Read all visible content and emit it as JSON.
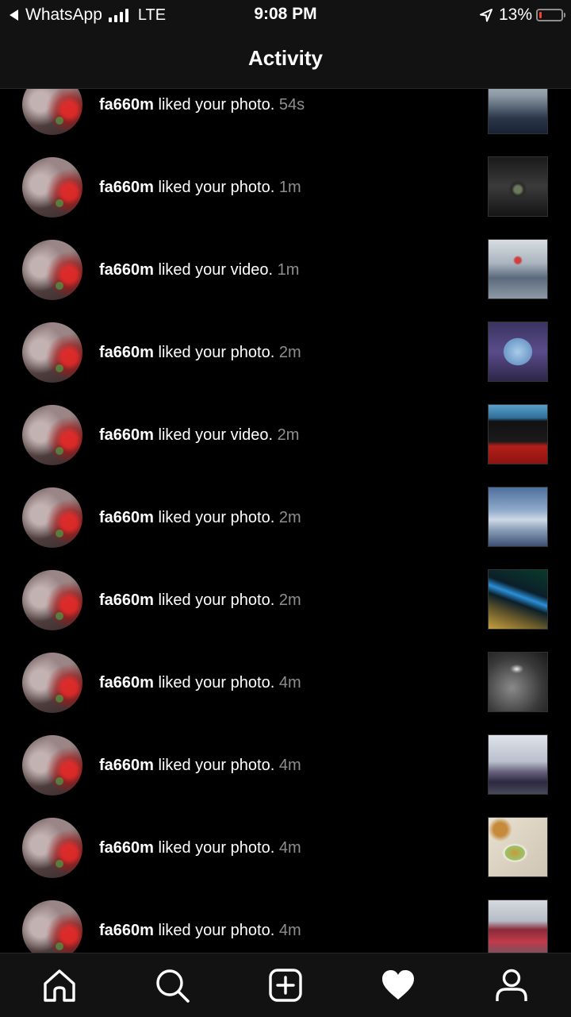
{
  "status_bar": {
    "back_app": "WhatsApp",
    "network": "LTE",
    "time": "9:08 PM",
    "battery_percent": "13%",
    "battery_level": 0.13,
    "battery_color": "#ff3b30",
    "icons": [
      "back-arrow-icon",
      "signal-icon",
      "location-icon",
      "battery-icon"
    ]
  },
  "header": {
    "title": "Activity"
  },
  "activity": {
    "items": [
      {
        "username": "fa660m",
        "action": " liked your photo.",
        "time": " 54s",
        "thumbnail": "cloudy-sea-sky"
      },
      {
        "username": "fa660m",
        "action": " liked your photo.",
        "time": " 1m",
        "thumbnail": "find-me-on-path-poster"
      },
      {
        "username": "fa660m",
        "action": " liked your video.",
        "time": " 1m",
        "thumbnail": "mall-interior-display"
      },
      {
        "username": "fa660m",
        "action": " liked your photo.",
        "time": " 2m",
        "thumbnail": "airplane-window-view"
      },
      {
        "username": "fa660m",
        "action": " liked your video.",
        "time": " 2m",
        "thumbnail": "grand-piano"
      },
      {
        "username": "fa660m",
        "action": " liked your photo.",
        "time": " 2m",
        "thumbnail": "clouds-from-above"
      },
      {
        "username": "fa660m",
        "action": " liked your photo.",
        "time": " 2m",
        "thumbnail": "neon-storefront-night"
      },
      {
        "username": "fa660m",
        "action": " liked your photo.",
        "time": " 4m",
        "thumbnail": "dark-ceiling-light"
      },
      {
        "username": "fa660m",
        "action": " liked your photo.",
        "time": " 4m",
        "thumbnail": "blue-mosque-skyline"
      },
      {
        "username": "fa660m",
        "action": " liked your photo.",
        "time": " 4m",
        "thumbnail": "dessert-and-tea"
      },
      {
        "username": "fa660m",
        "action": " liked your photo.",
        "time": " 4m",
        "thumbnail": "red-bus-street"
      }
    ]
  },
  "tab_bar": {
    "tabs": [
      {
        "name": "home",
        "icon": "home-icon",
        "active": false
      },
      {
        "name": "search",
        "icon": "search-icon",
        "active": false
      },
      {
        "name": "new-post",
        "icon": "add-post-icon",
        "active": false
      },
      {
        "name": "activity",
        "icon": "heart-icon",
        "active": true
      },
      {
        "name": "profile",
        "icon": "profile-icon",
        "active": false
      }
    ]
  }
}
